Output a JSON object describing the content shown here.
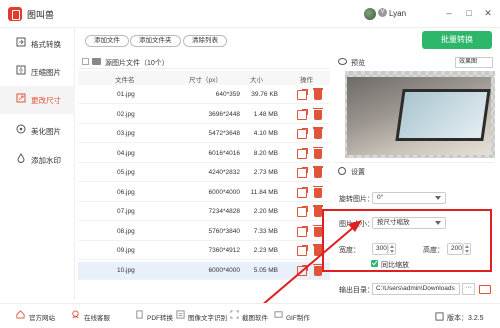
{
  "app": {
    "title": "图叫兽",
    "user": "Lyan",
    "window_controls": [
      "minimize-icon",
      "maximize-icon",
      "close-icon"
    ]
  },
  "sidebar": {
    "items": [
      {
        "label": "格式转换",
        "icon": "format-convert-icon",
        "active": false
      },
      {
        "label": "压缩图片",
        "icon": "compress-icon",
        "active": false
      },
      {
        "label": "更改尺寸",
        "icon": "resize-icon",
        "active": true
      },
      {
        "label": "美化图片",
        "icon": "beautify-icon",
        "active": false
      },
      {
        "label": "添加水印",
        "icon": "watermark-icon",
        "active": false
      }
    ]
  },
  "toolbar": {
    "add_file": "添加文件",
    "add_folder": "添加文件夹",
    "clear_list": "清除列表",
    "convert": "批量转换"
  },
  "file_panel": {
    "header": "源图片文件（10个）",
    "columns": {
      "name": "文件名",
      "dimensions": "尺寸（px）",
      "size": "大小",
      "ops": "操作"
    },
    "rows": [
      {
        "name": "01.jpg",
        "dimensions": "640*359",
        "size": "39.76 KB"
      },
      {
        "name": "02.jpg",
        "dimensions": "3696*2448",
        "size": "1.48 MB"
      },
      {
        "name": "03.jpg",
        "dimensions": "5472*3648",
        "size": "4.10 MB"
      },
      {
        "name": "04.jpg",
        "dimensions": "6016*4016",
        "size": "8.20 MB"
      },
      {
        "name": "05.jpg",
        "dimensions": "4240*2832",
        "size": "2.73 MB"
      },
      {
        "name": "06.jpg",
        "dimensions": "6000*4000",
        "size": "11.84 MB"
      },
      {
        "name": "07.jpg",
        "dimensions": "7234*4828",
        "size": "2.20 MB"
      },
      {
        "name": "08.jpg",
        "dimensions": "5760*3840",
        "size": "7.33 MB"
      },
      {
        "name": "09.jpg",
        "dimensions": "7360*4912",
        "size": "2.23 MB"
      },
      {
        "name": "10.jpg",
        "dimensions": "6000*4000",
        "size": "5.05 MB"
      }
    ]
  },
  "preview": {
    "title": "预览",
    "effect": "效果图"
  },
  "settings": {
    "title": "设置",
    "rotate_label": "旋转图片：",
    "rotate_value": "0°",
    "size_label": "图片大小：",
    "size_value": "按尺寸缩放",
    "width_label": "宽度：",
    "width_value": "300",
    "height_label": "高度：",
    "height_value": "200",
    "ratio_label": "同比缩放",
    "output_label": "输出目录：",
    "output_value": "C:\\Users\\admin\\Downloads"
  },
  "bottom": {
    "items": [
      {
        "label": "官方网站",
        "icon": "home-icon"
      },
      {
        "label": "在线客服",
        "icon": "support-icon"
      },
      {
        "label": "PDF转换",
        "icon": "pdf-icon"
      },
      {
        "label": "图像文字识别",
        "icon": "ocr-icon"
      },
      {
        "label": "截图软件",
        "icon": "screenshot-icon"
      },
      {
        "label": "GIF制作",
        "icon": "gif-icon"
      }
    ],
    "version": "版本：3.2.5"
  },
  "colors": {
    "accent": "#e0543a",
    "convert": "#2db76a",
    "highlight": "#e02020",
    "selected_row": "#e8f1fb"
  }
}
